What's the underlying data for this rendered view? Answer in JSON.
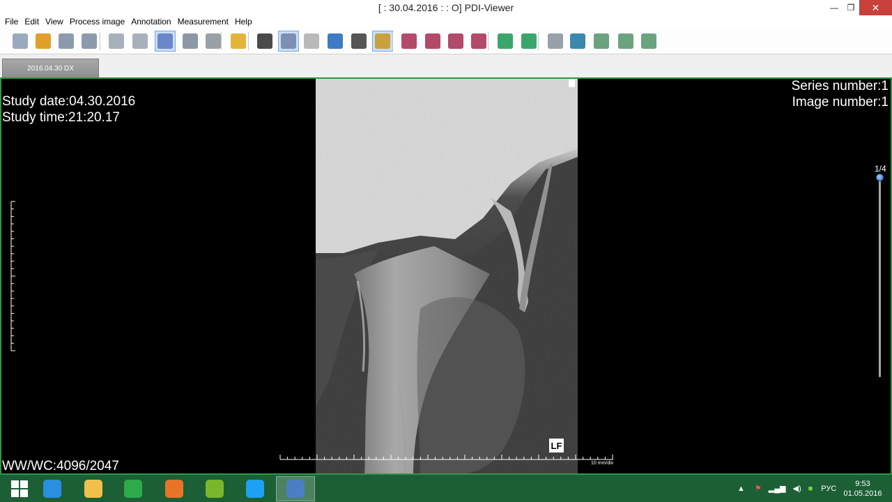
{
  "window": {
    "title": "[ : 30.04.2016 : : O] PDI-Viewer",
    "minimize_glyph": "—",
    "maximize_glyph": "❐",
    "close_glyph": "✕"
  },
  "menu": [
    "File",
    "Edit",
    "View",
    "Process image",
    "Annotation",
    "Measurement",
    "Help"
  ],
  "toolbar": {
    "tools": [
      {
        "icon": "list-icon",
        "color": "#9aa9bd"
      },
      {
        "icon": "refresh-icon",
        "color": "#e0a02a"
      },
      {
        "icon": "prev-patient-icon",
        "color": "#8c9aab"
      },
      {
        "icon": "next-patient-icon",
        "color": "#8c9aab"
      },
      {
        "icon": "prev-series-icon",
        "color": "#a8b0bb"
      },
      {
        "icon": "next-series-icon",
        "color": "#a8b0bb"
      },
      {
        "icon": "layout-grid-icon",
        "color": "#6b86c9"
      },
      {
        "icon": "copy-icon",
        "color": "#8c98a6"
      },
      {
        "icon": "grid-icon",
        "color": "#9aa0a8"
      },
      {
        "icon": "info-icon",
        "color": "#e4b43a"
      },
      {
        "icon": "window-level-icon",
        "color": "#4a4a4a"
      },
      {
        "icon": "select-icon",
        "color": "#7d90b3"
      },
      {
        "icon": "pan-hand-icon",
        "color": "#b9b9b9"
      },
      {
        "icon": "zoom-icon",
        "color": "#3d7bc4"
      },
      {
        "icon": "magnify-icon",
        "color": "#555555"
      },
      {
        "icon": "crosshair-icon",
        "color": "#c9a13d"
      },
      {
        "icon": "rotate-left-icon",
        "color": "#b34a6a"
      },
      {
        "icon": "rotate-right-icon",
        "color": "#b34a6a"
      },
      {
        "icon": "flip-horizontal-icon",
        "color": "#b34a6a"
      },
      {
        "icon": "flip-vertical-icon",
        "color": "#b34a6a"
      },
      {
        "icon": "line-icon",
        "color": "#3aa66b"
      },
      {
        "icon": "text-icon",
        "color": "#3aa66b"
      },
      {
        "icon": "ruler-icon",
        "color": "#9aa0a8"
      },
      {
        "icon": "angle-icon",
        "color": "#3a8ab0"
      },
      {
        "icon": "rectangle-roi-icon",
        "color": "#6aa37e"
      },
      {
        "icon": "ellipse-roi-icon",
        "color": "#6aa37e"
      },
      {
        "icon": "polygon-roi-icon",
        "color": "#6aa37e"
      }
    ],
    "active_tools": [
      "layout-grid-icon",
      "select-icon",
      "crosshair-icon"
    ]
  },
  "tabs": [
    {
      "label": "2016.04.30 DX"
    }
  ],
  "overlay": {
    "study_date": "Study date:04.30.2016",
    "study_time": "Study time:21:20.17",
    "series_number": "Series number:1",
    "image_number": "Image number:1",
    "window_level": "WW/WC:4096/2047",
    "orientation_marker": "LF",
    "scale_label": "10 mm/div",
    "frame_indicator": "1/4"
  },
  "taskbar": {
    "apps": [
      {
        "icon": "windows-start-icon",
        "color": "#ffffff"
      },
      {
        "icon": "internet-explorer-icon",
        "color": "#2b8fe0"
      },
      {
        "icon": "file-explorer-icon",
        "color": "#f0c04a"
      },
      {
        "icon": "windows-store-icon",
        "color": "#2faa4a"
      },
      {
        "icon": "firefox-icon",
        "color": "#e8742a"
      },
      {
        "icon": "utorrent-icon",
        "color": "#78b82a"
      },
      {
        "icon": "skype-icon",
        "color": "#1da1f2"
      },
      {
        "icon": "pdi-viewer-icon",
        "color": "#4a7fc4"
      }
    ],
    "active_app": "pdi-viewer-icon",
    "language": "РУС",
    "time": "9:53",
    "date": "01.05.2016"
  }
}
